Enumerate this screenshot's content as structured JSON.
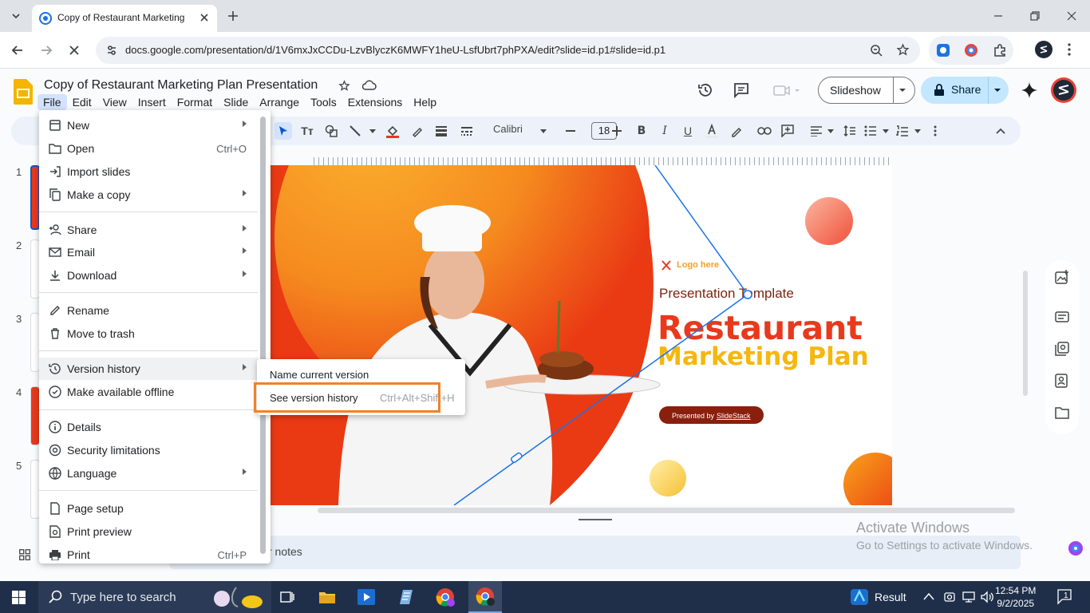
{
  "browser": {
    "tab_title": "Copy of Restaurant Marketing Plan Presentation",
    "url": "docs.google.com/presentation/d/1V6mxJxCCDu-LzvBlyczK6MWFY1heU-LsfUbrt7phPXA/edit?slide=id.p1#slide=id.p1"
  },
  "doc": {
    "title": "Copy of Restaurant Marketing Plan Presentation",
    "menu": [
      "File",
      "Edit",
      "View",
      "Insert",
      "Format",
      "Slide",
      "Arrange",
      "Tools",
      "Extensions",
      "Help"
    ],
    "slideshow_label": "Slideshow",
    "share_label": "Share"
  },
  "toolbar": {
    "font": "Calibri",
    "font_size": "18"
  },
  "filmstrip": {
    "slide_numbers": [
      "1",
      "2",
      "3",
      "4",
      "5"
    ]
  },
  "file_menu": {
    "items": [
      {
        "label": "New",
        "icon": "new-doc-icon",
        "submenu": true
      },
      {
        "label": "Open",
        "icon": "folder-icon",
        "shortcut": "Ctrl+O"
      },
      {
        "label": "Import slides",
        "icon": "import-icon"
      },
      {
        "label": "Make a copy",
        "icon": "copy-icon",
        "submenu": true
      },
      {
        "label": "Share",
        "icon": "person-add-icon",
        "submenu": true
      },
      {
        "label": "Email",
        "icon": "mail-icon",
        "submenu": true
      },
      {
        "label": "Download",
        "icon": "download-icon",
        "submenu": true
      },
      {
        "label": "Rename",
        "icon": "pencil-icon"
      },
      {
        "label": "Move to trash",
        "icon": "trash-icon"
      },
      {
        "label": "Version history",
        "icon": "history-icon",
        "submenu": true
      },
      {
        "label": "Make available offline",
        "icon": "offline-icon"
      },
      {
        "label": "Details",
        "icon": "info-icon"
      },
      {
        "label": "Security limitations",
        "icon": "security-icon"
      },
      {
        "label": "Language",
        "icon": "globe-icon",
        "submenu": true
      },
      {
        "label": "Page setup",
        "icon": "page-icon"
      },
      {
        "label": "Print preview",
        "icon": "print-preview-icon"
      },
      {
        "label": "Print",
        "icon": "printer-icon",
        "shortcut": "Ctrl+P"
      }
    ]
  },
  "version_submenu": {
    "name_current": "Name current version",
    "see_history": "See version history",
    "see_history_shortcut": "Ctrl+Alt+Shift+H"
  },
  "slide": {
    "logo_text": "Logo here",
    "subtitle": "Presentation Template",
    "title_line1": "Restaurant",
    "title_line2": "Marketing Plan",
    "presented_by": "Presented by",
    "presenter": "SlideStack"
  },
  "notes": {
    "label": "r notes"
  },
  "watermark": {
    "line1": "Activate Windows",
    "line2": "Go to Settings to activate Windows."
  },
  "taskbar": {
    "search_placeholder": "Type here to search",
    "result_label": "Result",
    "time": "12:54 PM",
    "date": "9/2/2025",
    "notification_count": "1"
  },
  "colors": {
    "accent_orange": "#f28227",
    "title_red": "#e8391d",
    "title_yellow": "#f5b70f",
    "share_blue": "#c2e7ff"
  }
}
